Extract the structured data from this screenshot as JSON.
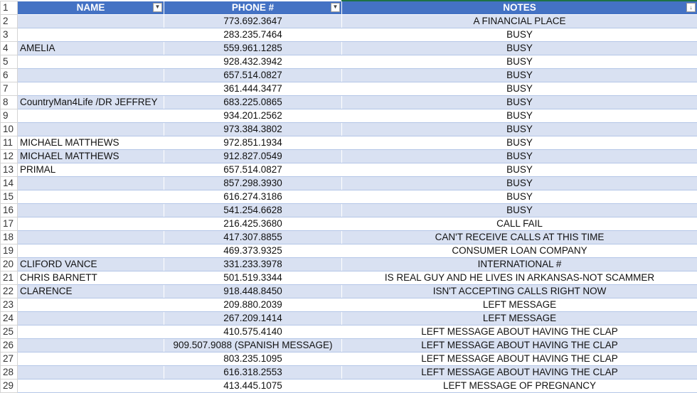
{
  "headers": {
    "row_number": "1",
    "name": "NAME",
    "phone": "PHONE #",
    "notes": "NOTES"
  },
  "rows": [
    {
      "rownum": "2",
      "name": "",
      "phone": "773.692.3647",
      "notes": "A FINANCIAL PLACE"
    },
    {
      "rownum": "3",
      "name": "",
      "phone": "283.235.7464",
      "notes": "BUSY"
    },
    {
      "rownum": "4",
      "name": "AMELIA",
      "phone": "559.961.1285",
      "notes": "BUSY"
    },
    {
      "rownum": "5",
      "name": "",
      "phone": "928.432.3942",
      "notes": "BUSY"
    },
    {
      "rownum": "6",
      "name": "",
      "phone": "657.514.0827",
      "notes": "BUSY"
    },
    {
      "rownum": "7",
      "name": "",
      "phone": "361.444.3477",
      "notes": "BUSY"
    },
    {
      "rownum": "8",
      "name": "CountryMan4Life /DR JEFFREY",
      "phone": "683.225.0865",
      "notes": "BUSY"
    },
    {
      "rownum": "9",
      "name": "",
      "phone": "934.201.2562",
      "notes": "BUSY"
    },
    {
      "rownum": "10",
      "name": "",
      "phone": "973.384.3802",
      "notes": "BUSY"
    },
    {
      "rownum": "11",
      "name": "MICHAEL MATTHEWS",
      "phone": "972.851.1934",
      "notes": "BUSY"
    },
    {
      "rownum": "12",
      "name": "MICHAEL MATTHEWS",
      "phone": "912.827.0549",
      "notes": "BUSY"
    },
    {
      "rownum": "13",
      "name": "PRIMAL",
      "phone": "657.514.0827",
      "notes": "BUSY"
    },
    {
      "rownum": "14",
      "name": "",
      "phone": "857.298.3930",
      "notes": "BUSY"
    },
    {
      "rownum": "15",
      "name": "",
      "phone": "616.274.3186",
      "notes": "BUSY"
    },
    {
      "rownum": "16",
      "name": "",
      "phone": "541.254.6628",
      "notes": "BUSY"
    },
    {
      "rownum": "17",
      "name": "",
      "phone": "216.425.3680",
      "notes": "CALL FAIL"
    },
    {
      "rownum": "18",
      "name": "",
      "phone": "417.307.8855",
      "notes": "CAN'T RECEIVE CALLS AT THIS TIME"
    },
    {
      "rownum": "19",
      "name": "",
      "phone": "469.373.9325",
      "notes": "CONSUMER LOAN COMPANY"
    },
    {
      "rownum": "20",
      "name": "CLIFORD VANCE",
      "phone": "331.233.3978",
      "notes": "INTERNATIONAL #"
    },
    {
      "rownum": "21",
      "name": "CHRIS BARNETT",
      "phone": "501.519.3344",
      "notes": "IS REAL GUY AND HE LIVES IN ARKANSAS-NOT SCAMMER"
    },
    {
      "rownum": "22",
      "name": "CLARENCE",
      "phone": "918.448.8450",
      "notes": "ISN'T ACCEPTING CALLS RIGHT NOW"
    },
    {
      "rownum": "23",
      "name": "",
      "phone": "209.880.2039",
      "notes": "LEFT MESSAGE"
    },
    {
      "rownum": "24",
      "name": "",
      "phone": "267.209.1414",
      "notes": "LEFT MESSAGE"
    },
    {
      "rownum": "25",
      "name": "",
      "phone": "410.575.4140",
      "notes": "LEFT MESSAGE ABOUT HAVING THE CLAP"
    },
    {
      "rownum": "26",
      "name": "",
      "phone": "909.507.9088 (SPANISH MESSAGE)",
      "notes": "LEFT MESSAGE ABOUT HAVING THE CLAP"
    },
    {
      "rownum": "27",
      "name": "",
      "phone": "803.235.1095",
      "notes": "LEFT MESSAGE ABOUT HAVING THE CLAP"
    },
    {
      "rownum": "28",
      "name": "",
      "phone": "616.318.2553",
      "notes": "LEFT MESSAGE ABOUT HAVING THE CLAP"
    },
    {
      "rownum": "29",
      "name": "",
      "phone": "413.445.1075",
      "notes": "LEFT MESSAGE OF PREGNANCY"
    }
  ],
  "icons": {
    "filter_dropdown": "filter-dropdown-icon",
    "sort_filter": "sort-filter-icon"
  },
  "colors": {
    "header_bg": "#4472c4",
    "band_bg": "#d9e1f2",
    "selected_border": "#1e7145"
  }
}
